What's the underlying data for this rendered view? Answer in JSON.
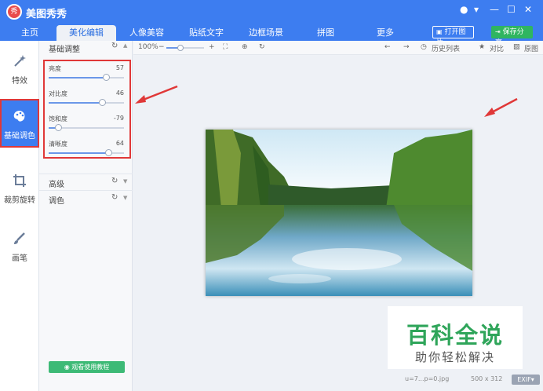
{
  "app": {
    "title": "美图秀秀",
    "logo_text": "秀"
  },
  "window_controls": [
    "●",
    "▾",
    "—",
    "☐",
    "✕"
  ],
  "nav": {
    "tabs": [
      "主页",
      "美化编辑",
      "人像美容",
      "贴纸文字",
      "边框场景",
      "拼图",
      "更多"
    ],
    "active_tab": "美化编辑",
    "open_image": "打开图片",
    "save_share": "保存分享"
  },
  "tools": [
    {
      "label": "特效",
      "icon": "magic-wand-icon"
    },
    {
      "label": "基础调色",
      "icon": "palette-icon"
    },
    {
      "label": "裁剪旋转",
      "icon": "crop-icon"
    },
    {
      "label": "画笔",
      "icon": "brush-icon"
    }
  ],
  "panel": {
    "header": "基础调整",
    "sliders": [
      {
        "label": "亮度",
        "value": "57",
        "fraction": 0.765
      },
      {
        "label": "对比度",
        "value": "46",
        "fraction": 0.71
      },
      {
        "label": "饱和度",
        "value": "-79",
        "fraction": 0.13
      },
      {
        "label": "清晰度",
        "value": "64",
        "fraction": 0.79
      }
    ],
    "sections": [
      "高级",
      "调色"
    ],
    "tutorial_button": "观看使用教程"
  },
  "toolbar": {
    "zoom": "100%",
    "zoom_fraction": 0.38,
    "history": "历史列表",
    "compare": "对比",
    "original": "原图"
  },
  "status": {
    "filename": "u=7...p=0.jpg",
    "dimensions": "500 x 312",
    "exif": "EXIF"
  },
  "watermark": {
    "title": "百科全说",
    "subtitle": "助你轻松解决"
  },
  "colors": {
    "accent": "#3d7df0",
    "highlight": "#e03838",
    "save": "#2fb560",
    "watermark": "#2fa55a"
  }
}
